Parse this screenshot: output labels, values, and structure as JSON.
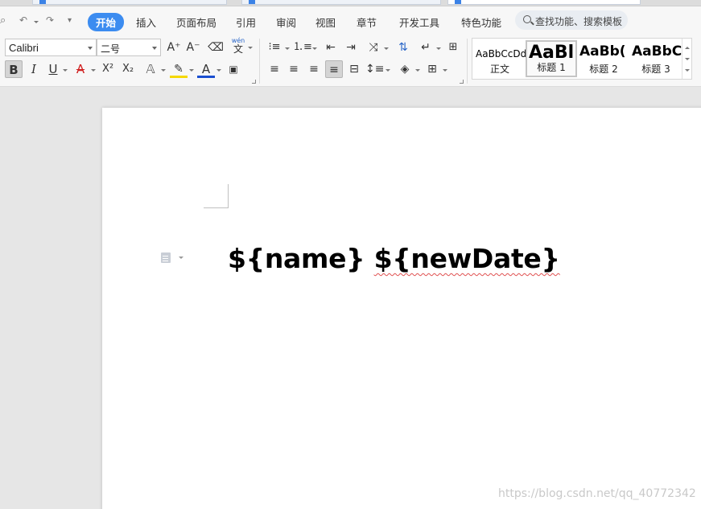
{
  "menu": {
    "tabs": [
      "开始",
      "插入",
      "页面布局",
      "引用",
      "审阅",
      "视图",
      "章节",
      "开发工具",
      "特色功能"
    ],
    "active_tab": "开始",
    "search_placeholder": "查找功能、搜索模板"
  },
  "ribbon": {
    "font_name": "Calibri",
    "font_size": "二号",
    "bold": "B",
    "italic": "I",
    "underline": "U",
    "superscript_glyph": "X²",
    "subscript_glyph": "X₂",
    "grow_font": "A⁺",
    "shrink_font": "A⁻",
    "phonetic": "wén"
  },
  "styles_gallery": [
    {
      "preview": "AaBbCcDd",
      "label": "正文",
      "selected": false
    },
    {
      "preview": "AaBl",
      "label": "标题 1",
      "selected": true
    },
    {
      "preview": "AaBb(",
      "label": "标题 2",
      "selected": false
    },
    {
      "preview": "AaBbC",
      "label": "标题 3",
      "selected": false
    }
  ],
  "document": {
    "text_plain": "${name} ",
    "text_misspelled": "${newDate}"
  },
  "watermark": "https://blog.csdn.net/qq_40772342",
  "colors": {
    "active_tab": "#3c8cf0",
    "highlight_yellow": "#f5d800",
    "font_color_red": "#d02020",
    "font_color_blue": "#1a4fd0"
  }
}
